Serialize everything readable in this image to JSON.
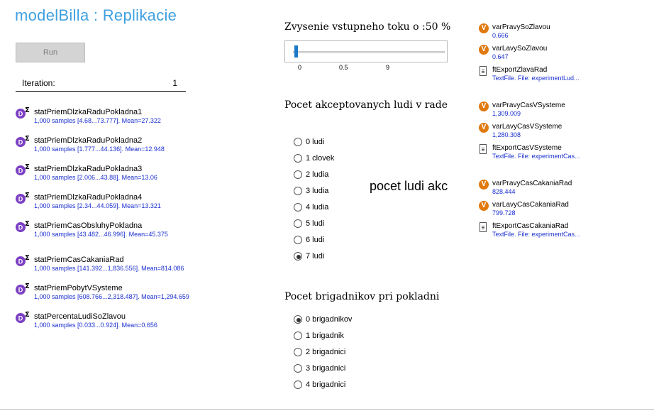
{
  "title": "modelBilla : Replikacie",
  "run_button": "Run",
  "iteration": {
    "label": "Iteration:",
    "value": "1"
  },
  "stats": [
    {
      "name": "statPriemDlzkaRaduPokladna1",
      "desc": "1,000 samples [4.68...73.777]. Mean=27.322"
    },
    {
      "name": "statPriemDlzkaRaduPokladna2",
      "desc": "1,000 samples [1.777...44.136]. Mean=12.948"
    },
    {
      "name": "statPriemDlzkaRaduPokladna3",
      "desc": "1,000 samples [2.006...43.88]. Mean=13.06"
    },
    {
      "name": "statPriemDlzkaRaduPokladna4",
      "desc": "1,000 samples [2.34...44.059]. Mean=13.321"
    },
    {
      "name": "statPriemCasObsluhyPokladna",
      "desc": "1,000 samples [43.482...46.996]. Mean=45.375"
    },
    {
      "name": "statPriemCasCakaniaRad",
      "desc": "1,000 samples [141.392...1,836.556]. Mean=814.086"
    },
    {
      "name": "statPriemPobytVSysteme",
      "desc": "1,000 samples [608.766...2,318.487]. Mean=1,294.659"
    },
    {
      "name": "statPercentaLudiSoZlavou",
      "desc": "1,000 samples [0.033...0.924]. Mean=0.656"
    }
  ],
  "slider": {
    "title": "Zvysenie vstupneho toku o :50 %",
    "ticks": [
      "0",
      "0.5",
      "9"
    ],
    "value": 0
  },
  "accepted": {
    "title": "Pocet akceptovanych ludi v rade",
    "options": [
      "0 ludi",
      "1 clovek",
      "2 ludia",
      "3 ludia",
      "4 ludia",
      "5 ludi",
      "6 ludi",
      "7 ludi"
    ],
    "selected_index": 7
  },
  "big_label": "pocet ludi akc",
  "brigadnici": {
    "title": "Pocet brigadnikov pri pokladni",
    "options": [
      "0 brigadnikov",
      "1 brigadnik",
      "2 brigadnici",
      "3 brigadnici",
      "4 brigadnici"
    ],
    "selected_index": 0
  },
  "variables": [
    {
      "type": "var",
      "icon": "V",
      "name": "varPravySoZlavou",
      "value": "0.666"
    },
    {
      "type": "var",
      "icon": "V",
      "name": "varLavySoZlavou",
      "value": "0.647"
    },
    {
      "type": "file",
      "name": "ftExportZlavaRad",
      "value": "TextFile. File: experimentLud..."
    },
    {
      "type": "var",
      "icon": "V",
      "name": "varPravyCasVSysteme",
      "value": "1,309.009"
    },
    {
      "type": "var",
      "icon": "V",
      "name": "varLavyCasVSysteme",
      "value": "1,280.308"
    },
    {
      "type": "file",
      "name": "ftExportCasVSysteme",
      "value": "TextFile. File: experimentCas..."
    },
    {
      "type": "var",
      "icon": "V",
      "name": "varPravyCasCakaniaRad",
      "value": "828.444"
    },
    {
      "type": "var",
      "icon": "V",
      "name": "varLavyCasCakaniaRad",
      "value": "799.728"
    },
    {
      "type": "file",
      "name": "ftExportCasCakaniaRad",
      "value": "TextFile. File: experimentCas..."
    }
  ],
  "colors": {
    "title": "#3ea0e0",
    "link_text": "#1a2fd0",
    "variable_icon": "#e07a10",
    "stat_icon": "#7b3fc4",
    "slider_thumb": "#1e78c8"
  }
}
